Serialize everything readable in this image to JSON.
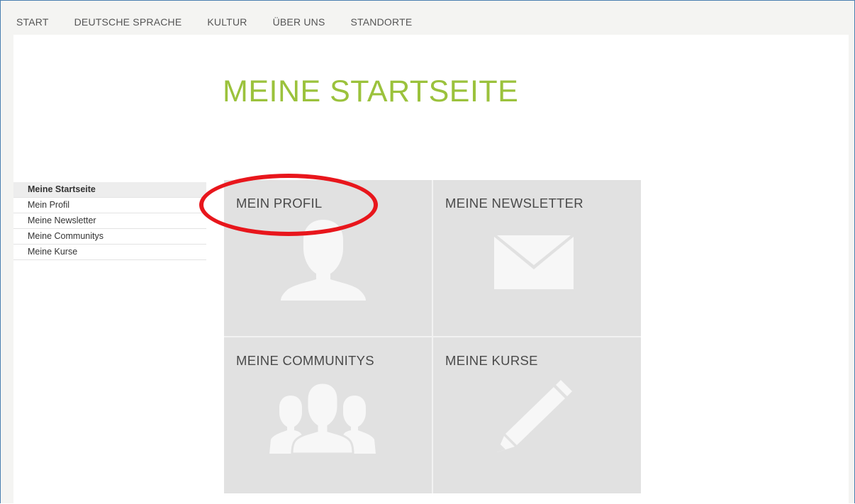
{
  "topnav": {
    "items": [
      {
        "label": "START"
      },
      {
        "label": "DEUTSCHE SPRACHE"
      },
      {
        "label": "KULTUR"
      },
      {
        "label": "ÜBER UNS"
      },
      {
        "label": "STANDORTE"
      }
    ]
  },
  "page": {
    "title": "MEINE STARTSEITE"
  },
  "sidebar": {
    "items": [
      {
        "label": "Meine Startseite",
        "active": true
      },
      {
        "label": "Mein Profil"
      },
      {
        "label": "Meine Newsletter"
      },
      {
        "label": "Meine Communitys"
      },
      {
        "label": "Meine Kurse"
      }
    ]
  },
  "tiles": [
    {
      "label": "MEIN PROFIL",
      "icon": "person-icon"
    },
    {
      "label": "MEINE NEWSLETTER",
      "icon": "envelope-icon"
    },
    {
      "label": "MEINE COMMUNITYS",
      "icon": "group-icon"
    },
    {
      "label": "MEINE KURSE",
      "icon": "pencil-icon"
    }
  ],
  "colors": {
    "title": "#9bc23c",
    "tile_bg": "#e1e1e1",
    "tile_icon": "#f7f7f7",
    "highlight": "#e8161c",
    "frame_border": "#4a7fb0"
  }
}
